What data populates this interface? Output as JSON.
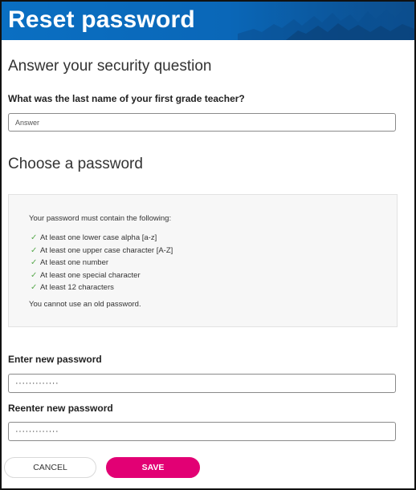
{
  "header": {
    "title": "Reset password"
  },
  "security": {
    "heading": "Answer your security question",
    "question": "What was the last name of your first grade teacher?",
    "answer_placeholder": "Answer"
  },
  "password": {
    "heading": "Choose a password",
    "requirements_intro": "Your password must contain the following:",
    "requirements": [
      {
        "icon": "check-icon",
        "text": "At least one lower case alpha [a-z]"
      },
      {
        "icon": "check-icon",
        "text": "At least one upper case character [A-Z]"
      },
      {
        "icon": "check-icon",
        "text": "At least one number"
      },
      {
        "icon": "check-icon",
        "text": "At least one special character"
      },
      {
        "icon": "check-icon",
        "text": "At least 12 characters"
      }
    ],
    "old_password_note": "You cannot use an old password.",
    "new_label": "Enter new password",
    "new_value": "·············",
    "reenter_label": "Reenter new password",
    "reenter_value": "·············"
  },
  "actions": {
    "cancel_label": "CANCEL",
    "save_label": "SAVE"
  },
  "colors": {
    "banner": "#0a6fc2",
    "accent": "#e20074",
    "check": "#5aaa4f"
  }
}
